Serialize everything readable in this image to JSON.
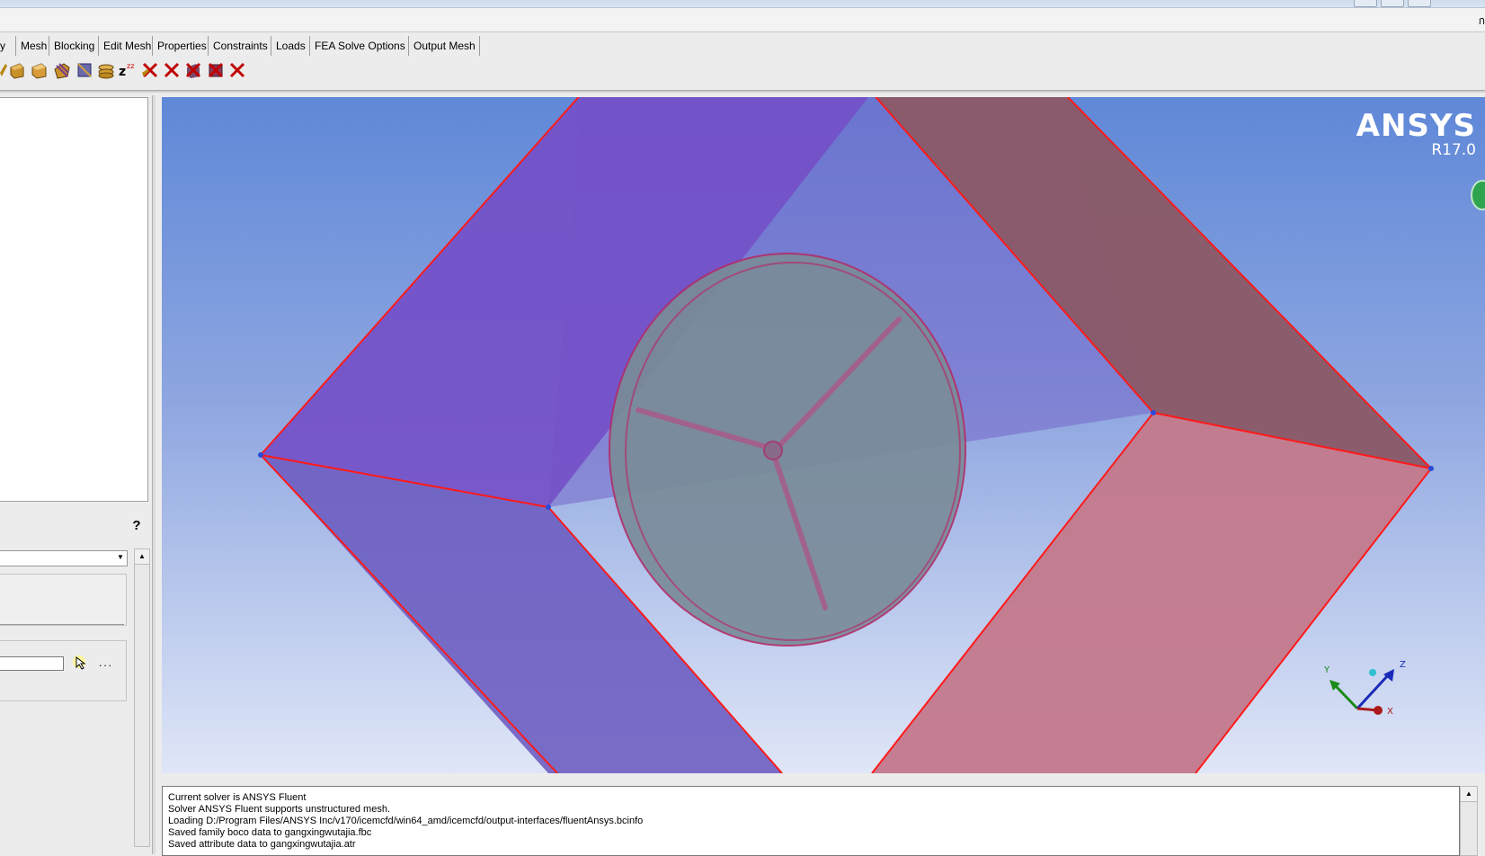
{
  "window": {
    "restore_glyph": "ก"
  },
  "tabs": [
    {
      "label": "y"
    },
    {
      "label": "Mesh"
    },
    {
      "label": "Blocking"
    },
    {
      "label": "Edit Mesh"
    },
    {
      "label": "Properties"
    },
    {
      "label": "Constraints"
    },
    {
      "label": "Loads"
    },
    {
      "label": "FEA Solve Options"
    },
    {
      "label": "Output Mesh"
    }
  ],
  "toolbar": {
    "icons": [
      "create-part-icon",
      "create-block-icon",
      "split-block-icon",
      "merge-block-icon",
      "edit-block-icon",
      "associate-icon",
      "sleep-z-icon",
      "delete-block-icon",
      "delete-edge-icon",
      "delete-face-icon",
      "delete-icon"
    ]
  },
  "panel": {
    "help_glyph": "?",
    "more_glyph": "..."
  },
  "viewport": {
    "brand_name": "ANSYS",
    "brand_version": "R17.0",
    "axes": {
      "y": "Y",
      "z": "Z",
      "x": "X"
    },
    "colors": {
      "purple_face": "#7a5bcb",
      "maroon_face": "#8a5a6a",
      "pink_face": "#c7788a",
      "sphere": "#7a8a9a",
      "edges": "#ff1a1a"
    }
  },
  "console": {
    "lines": [
      "Current solver is ANSYS Fluent",
      "Solver ANSYS Fluent supports unstructured mesh.",
      "Loading D:/Program Files/ANSYS Inc/v170/icemcfd/win64_amd/icemcfd/output-interfaces/fluentAnsys.bcinfo",
      "Saved family boco data to gangxingwutajia.fbc",
      "Saved attribute data to gangxingwutajia.atr"
    ]
  }
}
